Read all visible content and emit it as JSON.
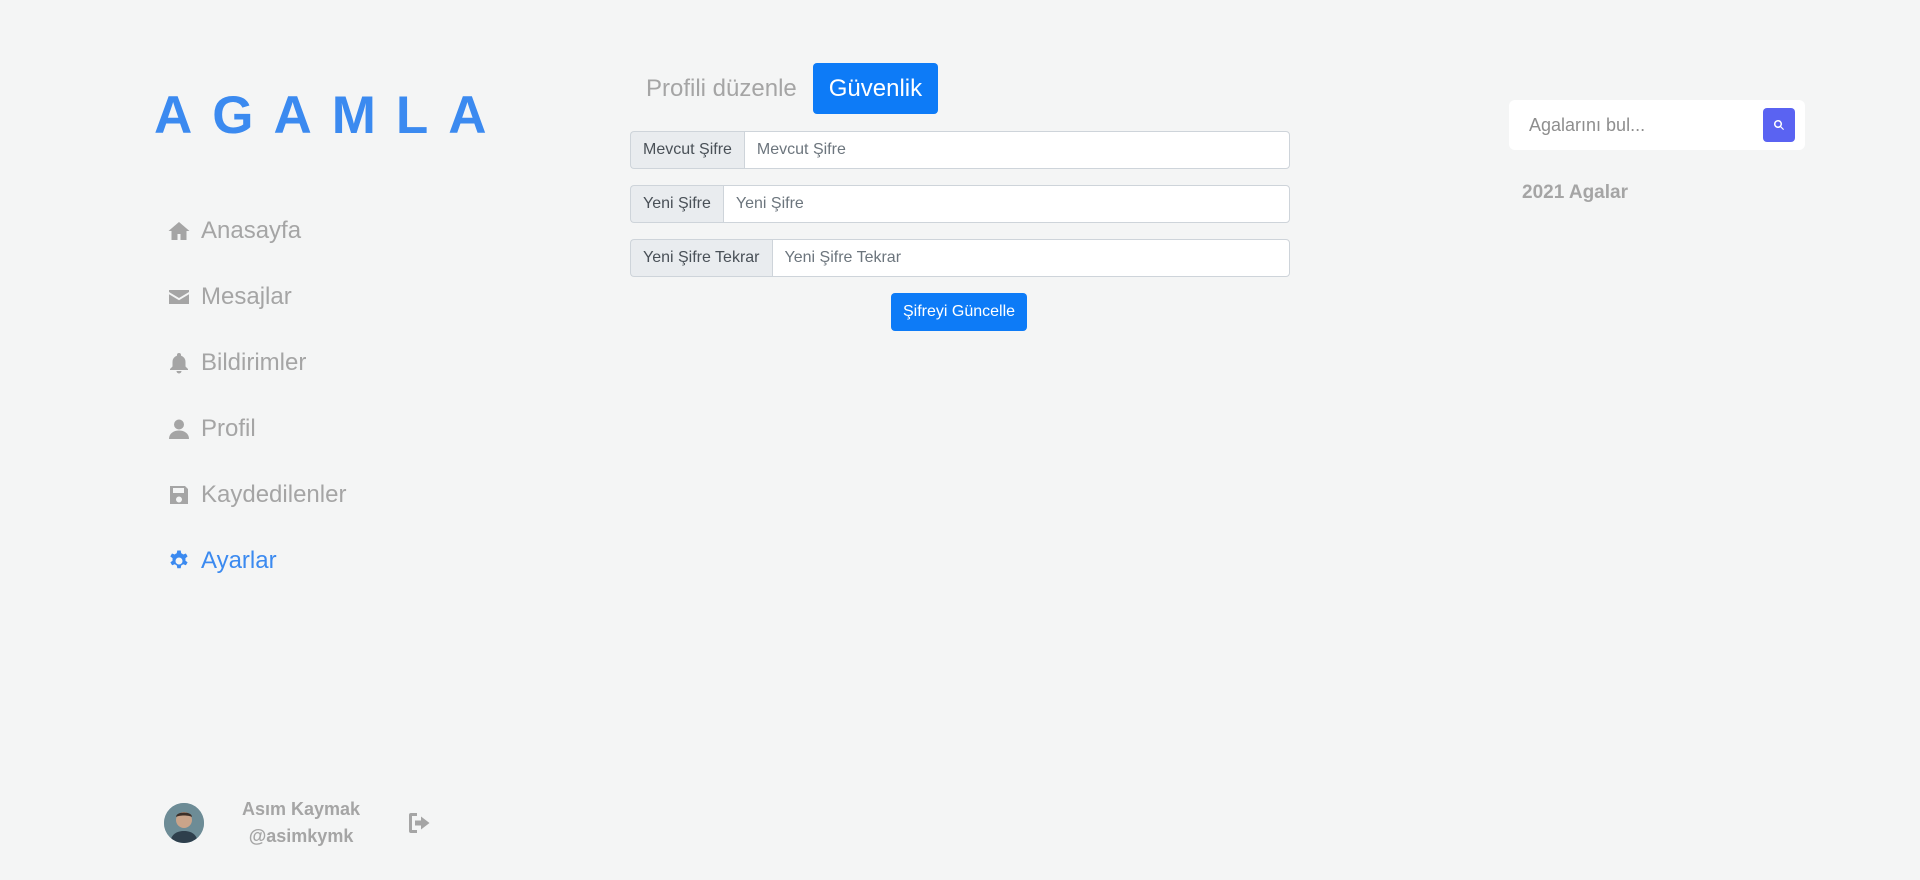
{
  "brand": {
    "logo": "AGAMLA",
    "accent": "#3b8af0"
  },
  "sidebar": {
    "items": [
      {
        "label": "Anasayfa",
        "icon": "home-icon",
        "active": false
      },
      {
        "label": "Mesajlar",
        "icon": "envelope-icon",
        "active": false
      },
      {
        "label": "Bildirimler",
        "icon": "bell-icon",
        "active": false
      },
      {
        "label": "Profil",
        "icon": "user-icon",
        "active": false
      },
      {
        "label": "Kaydedilenler",
        "icon": "save-icon",
        "active": false
      },
      {
        "label": "Ayarlar",
        "icon": "gear-icon",
        "active": true
      }
    ]
  },
  "user": {
    "name": "Asım Kaymak",
    "handle": "@asimkymk",
    "logout_icon": "logout-icon"
  },
  "tabs": [
    {
      "label": "Profili düzenle",
      "active": false
    },
    {
      "label": "Güvenlik",
      "active": true
    }
  ],
  "form": {
    "fields": [
      {
        "label": "Mevcut Şifre",
        "placeholder": "Mevcut Şifre",
        "value": ""
      },
      {
        "label": "Yeni Şifre",
        "placeholder": "Yeni Şifre",
        "value": ""
      },
      {
        "label": "Yeni Şifre Tekrar",
        "placeholder": "Yeni Şifre Tekrar",
        "value": ""
      }
    ],
    "submit_label": "Şifreyi Güncelle"
  },
  "search": {
    "placeholder": "Agalarını bul...",
    "icon": "search-icon"
  },
  "agalar_title": "2021 Agalar",
  "colors": {
    "primary": "#0d7bf7",
    "search_button": "#5a63f2",
    "muted": "#a5a5a5",
    "background": "#f4f5f5"
  }
}
